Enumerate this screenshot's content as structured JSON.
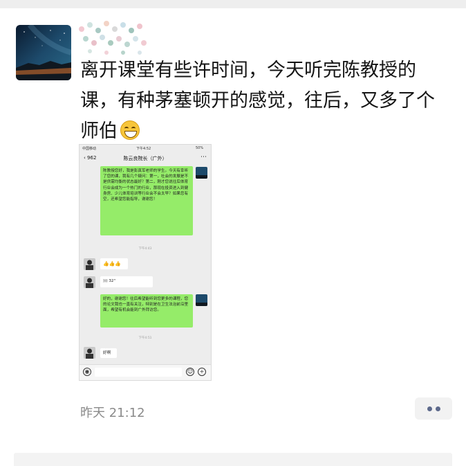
{
  "post": {
    "text": "离开课堂有些许时间，今天听完陈教授的课，有种茅塞顿开的感觉，往后，又多了个师伯",
    "emoji": "grinning-face-icon",
    "timestamp": "昨天 21:12"
  },
  "screenshot": {
    "status": {
      "carrier": "中国移动",
      "time": "下午4:52",
      "battery": "50%"
    },
    "header": {
      "back_count": "962",
      "title": "陈云良院长（广外）"
    },
    "messages": [
      {
        "side": "right",
        "text": "陈教授您好，我是彭真军老师的学生。今天有幸听了您的课，我有几个疑问：第一，社会的发展是不是供需均衡的状态最好？第二，刚才您说往后体育行业会成为一个热门的行业，那现在投资进入到健身房、少儿体育培训等行业会不会太早？如果您有空，还希望您能指导，谢谢您！"
      },
      {
        "type": "time",
        "text": "下午4:43"
      },
      {
        "side": "left",
        "text": "👍👍👍"
      },
      {
        "side": "left",
        "text": "32\""
      },
      {
        "side": "right",
        "text": "好的，谢谢您！往后希望能听到您更多的课程，您的论文我也一直有关注，特别是在卫生法治前沿里面，希望有机会能到广外拜访您。"
      },
      {
        "type": "time",
        "text": "下午4:51"
      },
      {
        "side": "left",
        "text": "好啊"
      }
    ]
  },
  "colors": {
    "bubble_green": "#95ec69",
    "timestamp": "#8a8a8a",
    "more_dots": "#5d6a8c"
  }
}
